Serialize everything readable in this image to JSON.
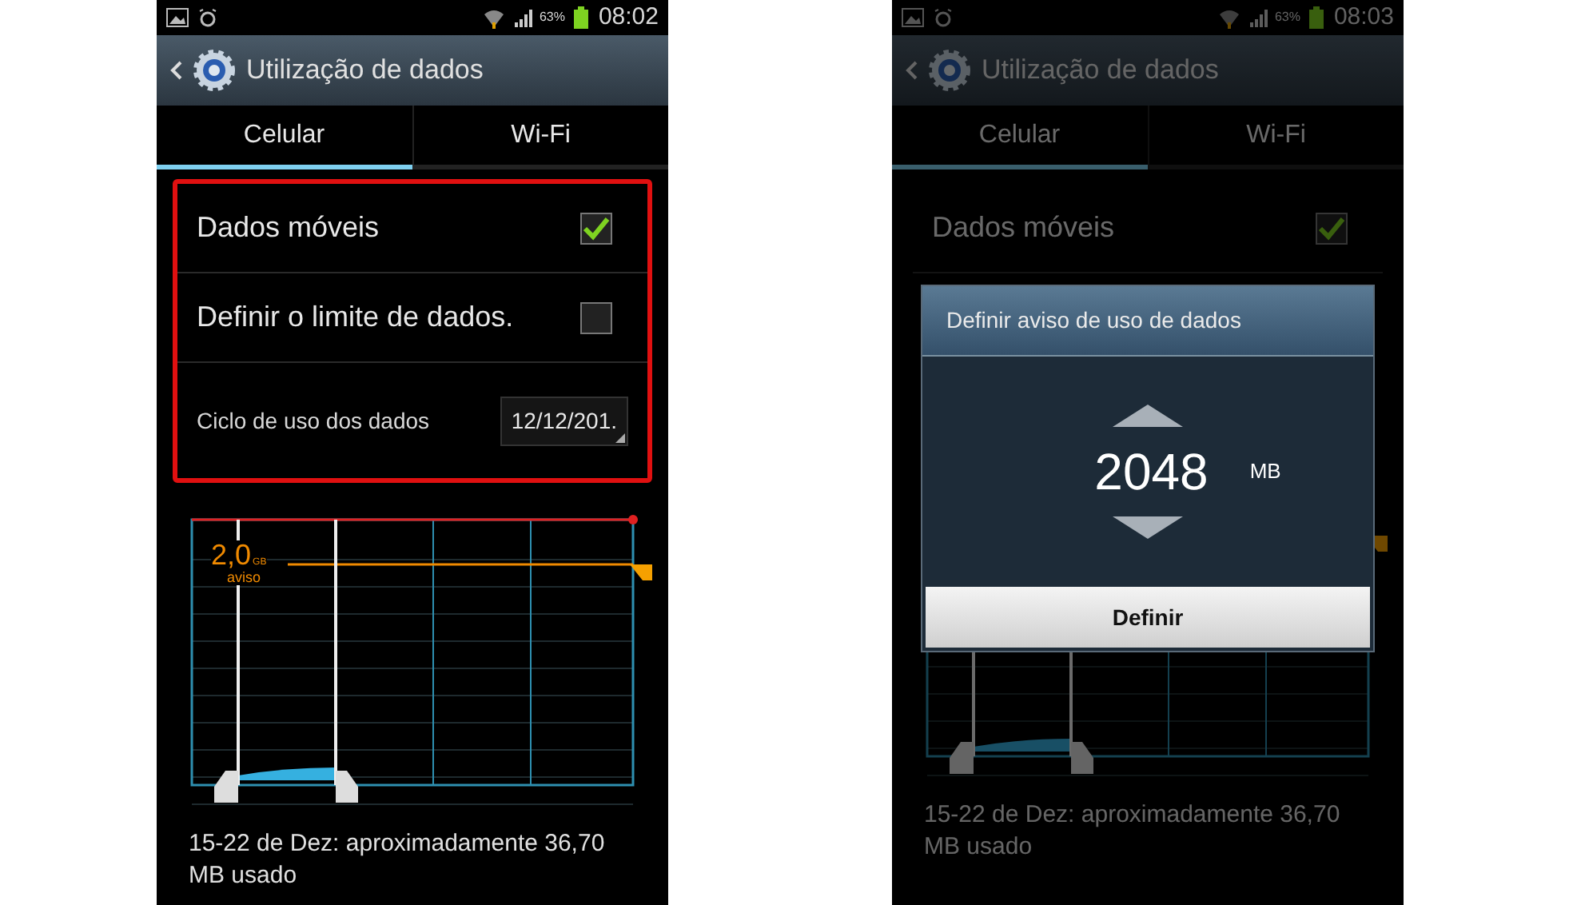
{
  "screens": [
    {
      "status_bar": {
        "battery": "63%",
        "time": "08:02"
      },
      "title": "Utilização de dados",
      "tabs": [
        {
          "label": "Celular",
          "selected": true
        },
        {
          "label": "Wi-Fi",
          "selected": false
        }
      ],
      "highlighted": true,
      "dimmed": false,
      "settings": [
        {
          "kind": "checkbox",
          "label": "Dados móveis",
          "checked": true
        },
        {
          "kind": "checkbox",
          "label": "Definir o limite de dados.",
          "checked": false
        },
        {
          "kind": "dropdown",
          "label": "Ciclo de uso dos dados",
          "value": "12/12/201."
        }
      ],
      "warning": {
        "value": "2,0",
        "unit": "GB",
        "label": "aviso"
      },
      "usage_text": "15-22 de Dez: aproximadamente 36,70 MB usado"
    },
    {
      "status_bar": {
        "battery": "63%",
        "time": "08:03"
      },
      "title": "Utilização de dados",
      "tabs": [
        {
          "label": "Celular",
          "selected": true
        },
        {
          "label": "Wi-Fi",
          "selected": false
        }
      ],
      "highlighted": false,
      "dimmed": true,
      "settings": [
        {
          "kind": "checkbox",
          "label": "Dados móveis",
          "checked": true
        }
      ],
      "usage_text": "15-22 de Dez: aproximadamente 36,70 MB usado",
      "dialog": {
        "title": "Definir aviso de uso de dados",
        "value": "2048",
        "unit": "MB",
        "button": "Definir"
      }
    }
  ]
}
